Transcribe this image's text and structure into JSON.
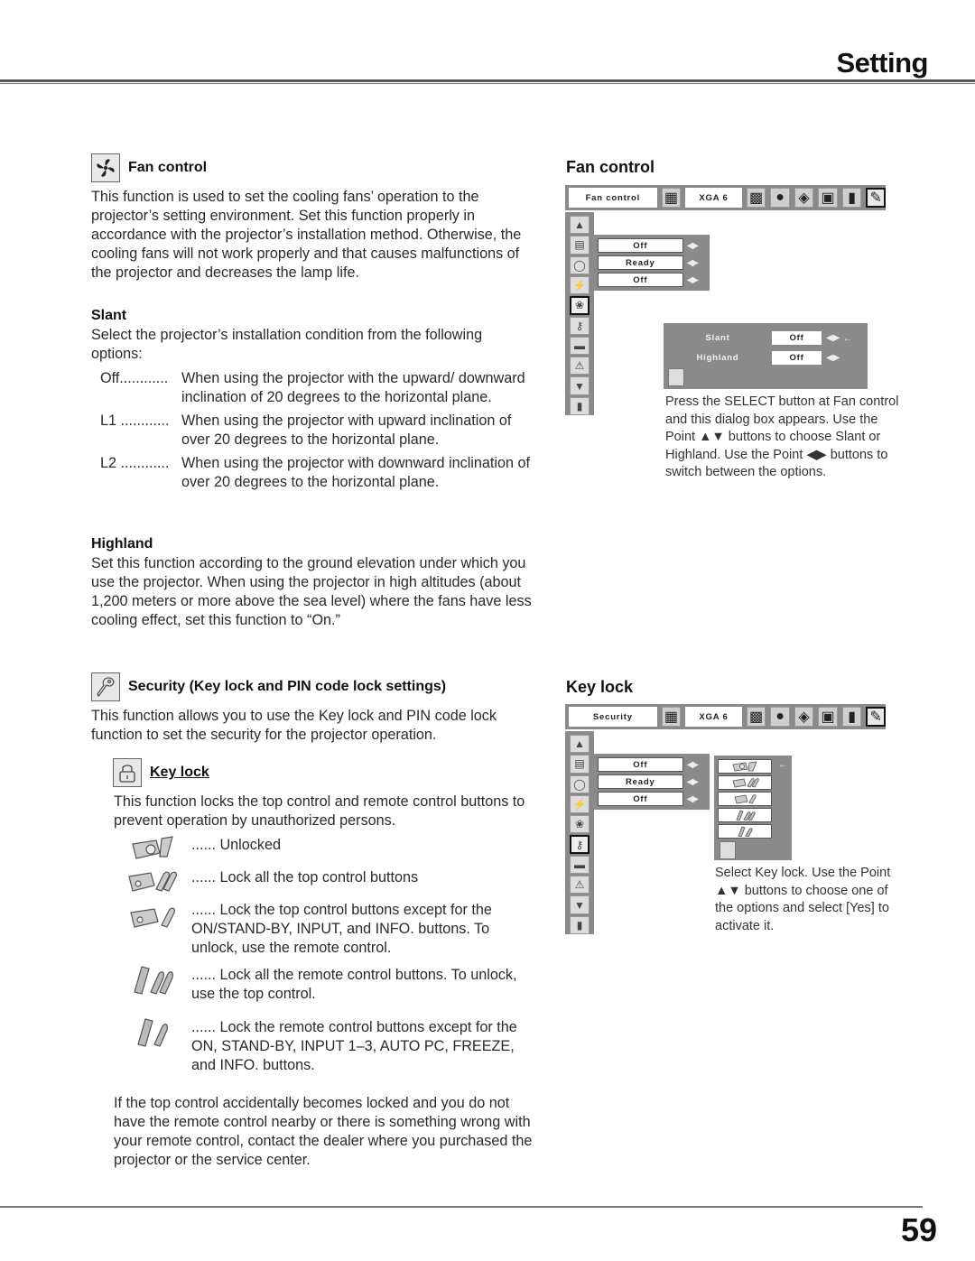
{
  "header": {
    "section_label": "Setting"
  },
  "footer": {
    "page_number": "59"
  },
  "fan_control": {
    "heading": "Fan control",
    "intro": "This function is used to set the cooling fans’ operation to the projector’s setting environment. Set this function properly in accordance with the projector’s installation method. Otherwise, the cooling fans will not work properly and that causes malfunctions of the projector and decreases the lamp life.",
    "slant": {
      "heading": "Slant",
      "intro": "Select the projector’s installation condition from the following options:",
      "options": [
        {
          "term": "Off............",
          "desc": "When using the projector with the upward/ downward inclination of 20 degrees to the horizontal plane."
        },
        {
          "term": "L1 ............",
          "desc": "When using the projector with upward inclination of over 20 degrees to the horizontal plane."
        },
        {
          "term": "L2 ............",
          "desc": "When using the projector with downward inclination of over 20 degrees to the horizontal plane."
        }
      ]
    },
    "highland": {
      "heading": "Highland",
      "text": "Set this function according to the ground elevation under which you use the projector. When using the projector in high altitudes (about 1,200 meters or more above the sea level) where the fans have less cooling effect, set this function to “On.”"
    }
  },
  "security": {
    "heading": "Security (Key lock and PIN code lock settings)",
    "intro": "This function allows you to use the Key lock and PIN code lock function to set the security for the projector operation.",
    "key_lock": {
      "heading": "Key lock",
      "intro": "This function locks the top control and remote control buttons to prevent operation by unauthorized persons.",
      "options": [
        {
          "icon": "unlocked-icon",
          "text": "...... Unlocked"
        },
        {
          "icon": "lock-all-top-icon",
          "text": "...... Lock all the top control buttons"
        },
        {
          "icon": "lock-top-except-icon",
          "text": "...... Lock the top control buttons except for the ON/STAND-BY, INPUT, and INFO. buttons. To unlock, use the remote control."
        },
        {
          "icon": "lock-all-remote-icon",
          "text": "...... Lock all the remote control buttons. To unlock, use the top control."
        },
        {
          "icon": "lock-remote-except-icon",
          "text": "...... Lock the remote control buttons except for the ON, STAND-BY, INPUT 1–3, AUTO PC, FREEZE, and INFO. buttons."
        }
      ],
      "note": "If the top control accidentally becomes locked and you do not have the remote control nearby or there is something wrong with your remote control, contact the dealer where you purchased the projector or the service center."
    }
  },
  "figures": {
    "fan_control": {
      "title": "Fan control",
      "menu_title": "Fan control",
      "input_label": "XGA 6",
      "values": [
        "Off",
        "Ready",
        "Off"
      ],
      "dialog": {
        "rows": [
          {
            "label": "Slant",
            "value": "Off"
          },
          {
            "label": "Highland",
            "value": "Off"
          }
        ]
      },
      "caption": "Press the SELECT button at Fan control and this dialog box appears. Use the Point ▲▼ buttons to choose Slant or Highland. Use the Point ◀▶ buttons to switch between the options."
    },
    "key_lock": {
      "title": "Key lock",
      "menu_title": "Security",
      "input_label": "XGA 6",
      "values": [
        "Off",
        "Ready",
        "Off"
      ],
      "caption": "Select Key lock. Use the Point ▲▼ buttons to choose one of the options and select [Yes] to activate it."
    }
  }
}
